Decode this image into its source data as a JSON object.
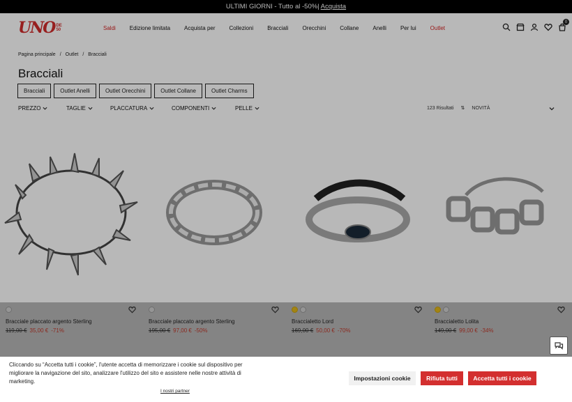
{
  "topbar": {
    "text": "ULTIMI GIORNI - Tutto al -50%|",
    "link": "Acquista"
  },
  "logo": {
    "main": "UNO",
    "sub1": "DE",
    "sub2": "50"
  },
  "nav": {
    "items": [
      "Saldi",
      "Edizione limitata",
      "Acquista per",
      "Collezioni",
      "Bracciali",
      "Orecchini",
      "Collane",
      "Anelli",
      "Per lui",
      "Outlet"
    ]
  },
  "cart": {
    "count": "0"
  },
  "breadcrumb": [
    "Pagina principale",
    "/",
    "Outlet",
    "/",
    "Bracciali"
  ],
  "page_title": "Bracciali",
  "chips": [
    "Bracciali",
    "Outlet Anelli",
    "Outlet Orecchini",
    "Outlet Collane",
    "Outlet Charms"
  ],
  "filters": [
    "PREZZO",
    "TAGLIE",
    "PLACCATURA",
    "COMPONENTI",
    "PELLE"
  ],
  "results": {
    "count": "123 Risultati",
    "sort": "NOVITÀ"
  },
  "products": [
    {
      "name": "Bracciale placcato argento Sterling",
      "old_price": "119,00 €",
      "new_price": "35,00 €",
      "discount": "-71%",
      "swatches": [
        "silver"
      ]
    },
    {
      "name": "Bracciale placcato argento Sterling",
      "old_price": "195,00 €",
      "new_price": "97,00 €",
      "discount": "-50%",
      "swatches": [
        "silver"
      ]
    },
    {
      "name": "Braccialetto Lord",
      "old_price": "169,00 €",
      "new_price": "50,00 €",
      "discount": "-70%",
      "swatches": [
        "gold",
        "silver"
      ]
    },
    {
      "name": "Braccialetto Lolita",
      "old_price": "149,00 €",
      "new_price": "99,00 €",
      "discount": "-34%",
      "swatches": [
        "gold",
        "silver"
      ]
    }
  ],
  "cookie": {
    "text": "Cliccando su “Accetta tutti i cookie”, l'utente accetta di memorizzare i cookie sul dispositivo per migliorare la navigazione del sito, analizzare l'utilizzo del sito e assistere nelle nostre attività di marketing.",
    "partners": "I nostri partner",
    "settings": "Impostazioni cookie",
    "reject": "Rifiuta tutti",
    "accept": "Accetta tutti i cookie"
  },
  "colors": {
    "brand": "#d12b2b",
    "cookie_button": "#d32f2f",
    "overlay": "rgba(0,0,0,0.28)"
  }
}
